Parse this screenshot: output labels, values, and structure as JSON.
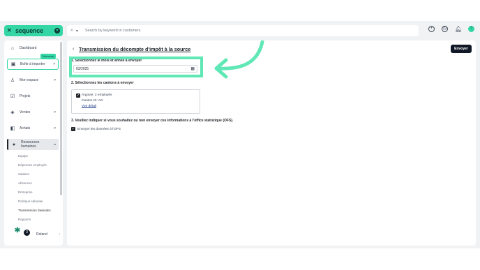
{
  "brand": {
    "name": "sequence"
  },
  "search": {
    "placeholder": "Search by keyword in customers"
  },
  "sidebar": {
    "new_badge": "Nouveau",
    "items": [
      {
        "label": "Dashboard"
      },
      {
        "label": "Boîte à importer"
      },
      {
        "label": "Mon espace"
      },
      {
        "label": "Projets"
      },
      {
        "label": "Ventes"
      },
      {
        "label": "Achats"
      },
      {
        "label": "Ressources humaines"
      }
    ],
    "sub_items": [
      {
        "label": "Equipe"
      },
      {
        "label": "Dépenses employés"
      },
      {
        "label": "Salaires"
      },
      {
        "label": "Absences"
      },
      {
        "label": "Entreprise"
      },
      {
        "label": "Politique salariale"
      },
      {
        "label": "Transmission Swissdec"
      },
      {
        "label": "Rapports"
      }
    ],
    "footer_user": "Roland",
    "help_count": "3"
  },
  "main": {
    "title": "Transmission du décompte d'impôt à la source",
    "send_label": "Envoyer",
    "step1": "1. Sélectionnez le mois et année à envoyer",
    "date_value": "03/2025",
    "step2": "2. Sélectionnez les cantons à envoyer",
    "canton_name": "Argovie: 2 employés",
    "canton_sub": "Canton IS: AG",
    "canton_link": "Voir détail",
    "step3": "3. Veuillez indiquer si vous souhaitez ou non envoyer ces informations à l'office statistique (OFS).",
    "ofs_label": "Envoyer les données à l'OFS"
  },
  "colors": {
    "accent": "#34d6a6",
    "highlight": "#5fe8b6",
    "dark": "#111827"
  }
}
